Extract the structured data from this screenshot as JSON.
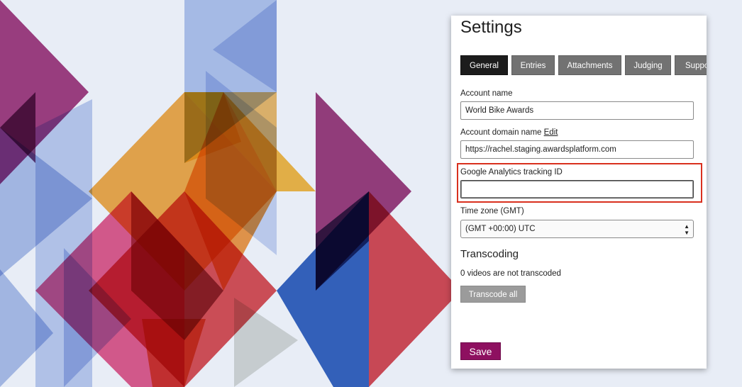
{
  "settings": {
    "title": "Settings",
    "tabs": [
      {
        "label": "General",
        "active": true
      },
      {
        "label": "Entries",
        "active": false
      },
      {
        "label": "Attachments",
        "active": false
      },
      {
        "label": "Judging",
        "active": false
      },
      {
        "label": "Support",
        "active": false
      }
    ],
    "account_name": {
      "label": "Account name",
      "value": "World Bike Awards"
    },
    "account_domain": {
      "label": "Account domain name",
      "edit_link": "Edit",
      "value": "https://rachel.staging.awardsplatform.com"
    },
    "analytics": {
      "label": "Google Analytics tracking ID",
      "value": ""
    },
    "timezone": {
      "label": "Time zone (GMT)",
      "selected": "(GMT +00:00) UTC"
    },
    "transcoding": {
      "title": "Transcoding",
      "status": "0 videos are not transcoded",
      "button_label": "Transcode all"
    },
    "save_label": "Save"
  },
  "colors": {
    "highlight_border": "#d9301e",
    "save_button": "#8e1060",
    "active_tab": "#1c1c1c",
    "inactive_tab": "#727272"
  }
}
